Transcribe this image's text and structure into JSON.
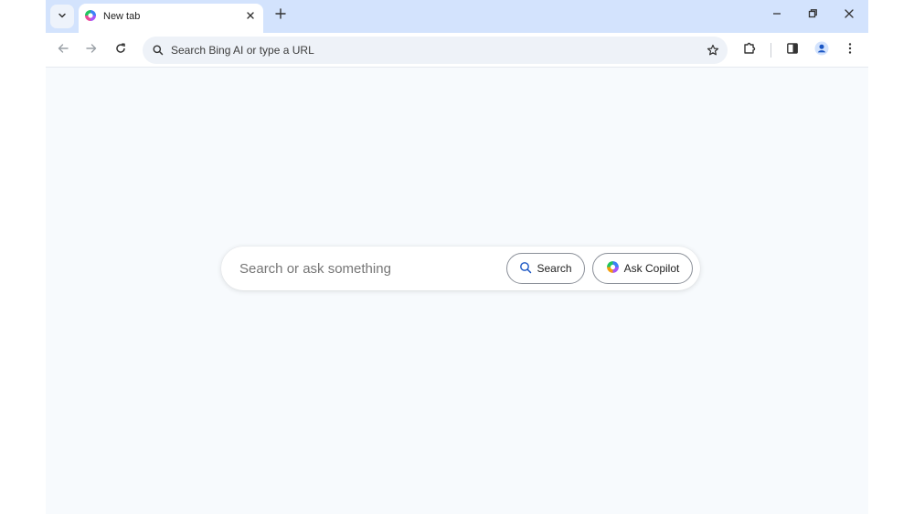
{
  "tab": {
    "title": "New tab"
  },
  "omnibox": {
    "placeholder": "Search Bing AI or type a URL"
  },
  "search": {
    "placeholder": "Search or ask something",
    "search_label": "Search",
    "copilot_label": "Ask Copilot"
  },
  "icons": {
    "tab_search": "chevron-down-icon",
    "new_tab": "plus-icon",
    "minimize": "minimize-icon",
    "restore": "restore-icon",
    "close": "close-icon",
    "back": "arrow-left-icon",
    "forward": "arrow-right-icon",
    "reload": "reload-icon",
    "bookmark": "star-icon",
    "extensions": "puzzle-icon",
    "side_panel": "side-panel-icon",
    "profile": "profile-icon",
    "menu": "kebab-menu-icon"
  },
  "colors": {
    "tabstrip": "#d3e3fd",
    "page_background": "#f7fafd",
    "profile_accent": "#1a56c4"
  }
}
